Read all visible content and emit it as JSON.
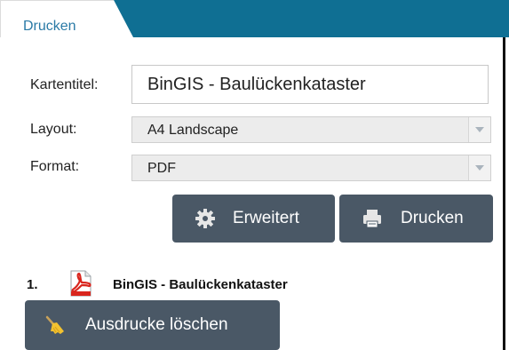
{
  "tab": {
    "label": "Drucken",
    "accent_color": "#0f6f93"
  },
  "form": {
    "title_label": "Kartentitel:",
    "title_value": "BinGIS - Baulückenkataster",
    "layout_label": "Layout:",
    "layout_value": "A4 Landscape",
    "format_label": "Format:",
    "format_value": "PDF"
  },
  "buttons": {
    "advanced_label": "Erweitert",
    "advanced_icon": "gear-icon",
    "print_label": "Drucken",
    "print_icon": "printer-icon",
    "clear_label": "Ausdrucke löschen",
    "clear_icon": "broom-icon",
    "color": "#4a5866"
  },
  "results": [
    {
      "number": "1.",
      "icon": "pdf-file-icon",
      "title": "BinGIS - Baulückenkataster"
    }
  ]
}
